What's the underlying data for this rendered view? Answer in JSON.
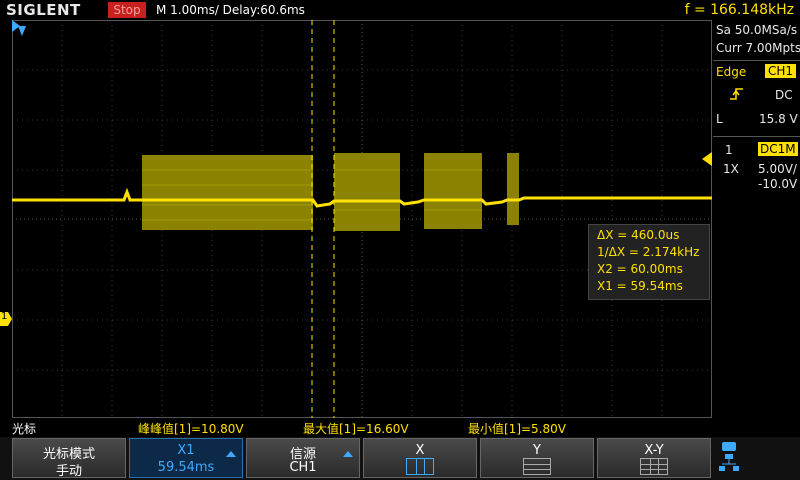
{
  "header": {
    "logo": "SIGLENT",
    "status": "Stop",
    "timebase": "M 1.00ms/ Delay:60.6ms",
    "frequency": "f = 166.148kHz"
  },
  "acquisition": {
    "sample_rate": "Sa 50.0MSa/s",
    "memory_depth": "Curr 7.00Mpts"
  },
  "trigger": {
    "label": "Edge",
    "source": "CH1",
    "coupling": "DC",
    "level_marker": "L",
    "level": "15.8 V"
  },
  "channel": {
    "number": "1",
    "impedance": "DC1M",
    "probe": "1X",
    "scale": "5.00V/",
    "offset": "-10.0V",
    "marker": "1"
  },
  "cursor_measurements": [
    "ΔX = 460.0us",
    "1/ΔX = 2.174kHz",
    "X2 = 60.00ms",
    "X1 = 59.54ms"
  ],
  "measure_bar": {
    "title": "光标",
    "peak_to_peak": "峰峰值[1]=10.80V",
    "maximum": "最大值[1]=16.60V",
    "minimum": "最小值[1]=5.80V"
  },
  "softkeys": [
    {
      "line1": "光标模式",
      "line2": "手动"
    },
    {
      "line1": "X1",
      "line2": "59.54ms"
    },
    {
      "line1": "信源",
      "line2": "CH1"
    },
    {
      "line1": "X",
      "line2": ""
    },
    {
      "line1": "Y",
      "line2": ""
    },
    {
      "line1": "X-Y",
      "line2": ""
    }
  ],
  "colors": {
    "trace": "#ffe000",
    "accent": "#3fa9ff",
    "stop": "#c8201e"
  },
  "icons": [
    "trigger-edge-icon",
    "network-icon",
    "cursor-x-icon",
    "cursor-y-icon",
    "cursor-xy-icon"
  ]
}
